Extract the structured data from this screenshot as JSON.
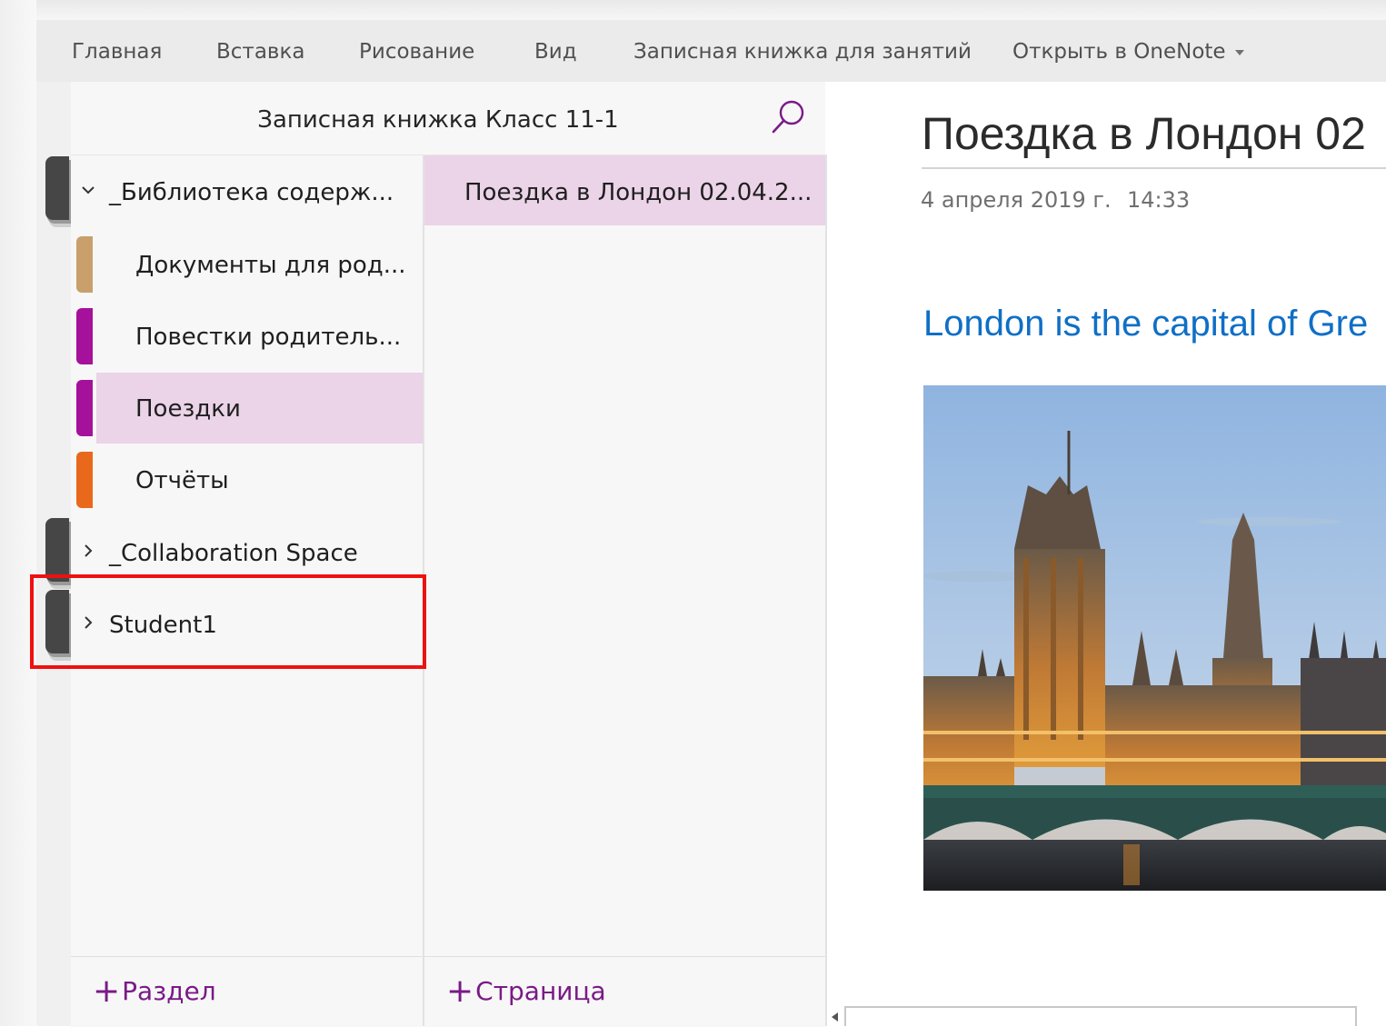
{
  "ribbon": {
    "tabs": [
      "Главная",
      "Вставка",
      "Рисование",
      "Вид",
      "Записная книжка для занятий",
      "Открыть в OneNote"
    ]
  },
  "notebook": {
    "title": "Записная книжка Класс 11-1",
    "groups": [
      {
        "label": "_Библиотека содерж...",
        "expanded": true,
        "sections": [
          {
            "label": "Документы для род...",
            "color": "#c9a06c"
          },
          {
            "label": "Повестки родитель...",
            "color": "#a5119a"
          },
          {
            "label": "Поездки",
            "color": "#a5119a",
            "selected": true
          },
          {
            "label": "Отчёты",
            "color": "#e8691b"
          }
        ]
      },
      {
        "label": "_Collaboration Space",
        "expanded": false
      },
      {
        "label": "Student1",
        "expanded": false,
        "highlighted": true
      }
    ],
    "add_section": "Раздел"
  },
  "pages": {
    "items": [
      {
        "label": "Поездка в Лондон 02.04.2...",
        "selected": true
      }
    ],
    "add_page": "Страница"
  },
  "page": {
    "title": "Поездка в Лондон 02",
    "date": "4 апреля 2019 г.",
    "time": "14:33",
    "heading": "London is the capital of Gre",
    "image": "houses-of-parliament-photo"
  },
  "colors": {
    "accent": "#7a1a86",
    "highlight": "#ee1111",
    "heading": "#0f6fc6",
    "selected_bg": "#ebd3e8"
  }
}
